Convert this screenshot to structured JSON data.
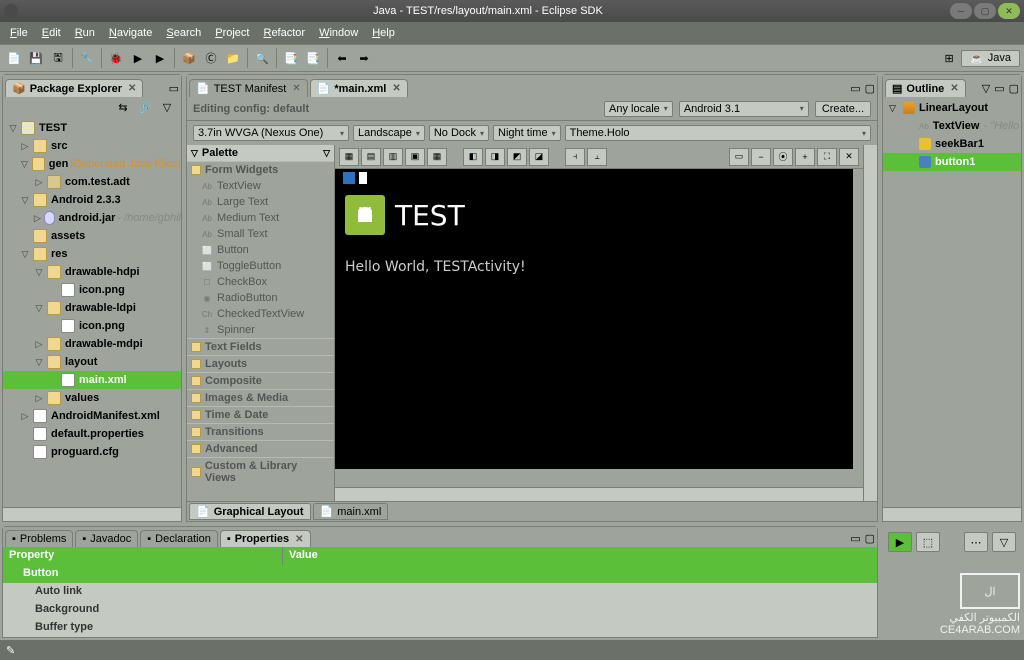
{
  "window": {
    "title": "Java - TEST/res/layout/main.xml - Eclipse SDK"
  },
  "menu": [
    "File",
    "Edit",
    "Run",
    "Navigate",
    "Search",
    "Project",
    "Refactor",
    "Window",
    "Help"
  ],
  "perspective": {
    "label": "Java"
  },
  "packageExplorer": {
    "title": "Package Explorer",
    "tree": [
      {
        "d": 0,
        "tw": "▽",
        "icon": "ic-proj",
        "label": "TEST"
      },
      {
        "d": 1,
        "tw": "▷",
        "icon": "ic-fold",
        "label": "src"
      },
      {
        "d": 1,
        "tw": "▽",
        "icon": "ic-foldG",
        "label": "gen",
        "suffix": "[Generated Java Files]",
        "sufCls": "gen"
      },
      {
        "d": 2,
        "tw": "▷",
        "icon": "ic-pkg",
        "label": "com.test.adt"
      },
      {
        "d": 1,
        "tw": "▽",
        "icon": "ic-fold",
        "label": "Android 2.3.3"
      },
      {
        "d": 2,
        "tw": "▷",
        "icon": "ic-jar",
        "label": "android.jar",
        "suffix": "- /home/gbhil",
        "sufCls": "muted"
      },
      {
        "d": 1,
        "tw": "",
        "icon": "ic-fold",
        "label": "assets"
      },
      {
        "d": 1,
        "tw": "▽",
        "icon": "ic-fold",
        "label": "res"
      },
      {
        "d": 2,
        "tw": "▽",
        "icon": "ic-fold",
        "label": "drawable-hdpi"
      },
      {
        "d": 3,
        "tw": "",
        "icon": "ic-img",
        "label": "icon.png"
      },
      {
        "d": 2,
        "tw": "▽",
        "icon": "ic-fold",
        "label": "drawable-ldpi"
      },
      {
        "d": 3,
        "tw": "",
        "icon": "ic-img",
        "label": "icon.png"
      },
      {
        "d": 2,
        "tw": "▷",
        "icon": "ic-fold",
        "label": "drawable-mdpi"
      },
      {
        "d": 2,
        "tw": "▽",
        "icon": "ic-fold",
        "label": "layout"
      },
      {
        "d": 3,
        "tw": "",
        "icon": "ic-xml",
        "label": "main.xml",
        "sel": true
      },
      {
        "d": 2,
        "tw": "▷",
        "icon": "ic-fold",
        "label": "values"
      },
      {
        "d": 1,
        "tw": "▷",
        "icon": "ic-xml",
        "label": "AndroidManifest.xml"
      },
      {
        "d": 1,
        "tw": "",
        "icon": "ic-file",
        "label": "default.properties"
      },
      {
        "d": 1,
        "tw": "",
        "icon": "ic-file",
        "label": "proguard.cfg"
      }
    ]
  },
  "editor": {
    "tabs": [
      {
        "label": "TEST Manifest",
        "active": false
      },
      {
        "label": "*main.xml",
        "active": true
      }
    ],
    "config": {
      "label": "Editing config:",
      "value": "default",
      "locale": "Any locale",
      "platform": "Android 3.1",
      "createBtn": "Create..."
    },
    "row2": {
      "device": "3.7in WVGA (Nexus One)",
      "orientation": "Landscape",
      "dock": "No Dock",
      "daynight": "Night time",
      "theme": "Theme.Holo"
    },
    "palette": {
      "title": "Palette",
      "sections": [
        {
          "type": "sect",
          "label": "Form Widgets"
        },
        {
          "type": "item",
          "icon": "Ab",
          "label": "TextView"
        },
        {
          "type": "item",
          "icon": "Ab",
          "label": "Large Text"
        },
        {
          "type": "item",
          "icon": "Ab",
          "label": "Medium Text"
        },
        {
          "type": "item",
          "icon": "Ab",
          "label": "Small Text"
        },
        {
          "type": "item",
          "icon": "⬜",
          "label": "Button"
        },
        {
          "type": "item",
          "icon": "⬜",
          "label": "ToggleButton"
        },
        {
          "type": "item",
          "icon": "☐",
          "label": "CheckBox"
        },
        {
          "type": "item",
          "icon": "◉",
          "label": "RadioButton"
        },
        {
          "type": "item",
          "icon": "Ch",
          "label": "CheckedTextView"
        },
        {
          "type": "item",
          "icon": "⇕",
          "label": "Spinner"
        },
        {
          "type": "sect",
          "label": "Text Fields"
        },
        {
          "type": "sect",
          "label": "Layouts"
        },
        {
          "type": "sect",
          "label": "Composite"
        },
        {
          "type": "sect",
          "label": "Images & Media"
        },
        {
          "type": "sect",
          "label": "Time & Date"
        },
        {
          "type": "sect",
          "label": "Transitions"
        },
        {
          "type": "sect",
          "label": "Advanced"
        },
        {
          "type": "sect",
          "label": "Custom & Library Views"
        }
      ]
    },
    "preview": {
      "title": "TEST",
      "hello": "Hello World, TESTActivity!"
    },
    "bottomTabs": [
      {
        "label": "Graphical Layout",
        "active": true
      },
      {
        "label": "main.xml",
        "active": false
      }
    ]
  },
  "outline": {
    "title": "Outline",
    "tree": [
      {
        "d": 0,
        "tw": "▽",
        "icon": "ic-ll",
        "label": "LinearLayout"
      },
      {
        "d": 1,
        "tw": "",
        "icon": "ic-tv",
        "pre": "Ab",
        "label": "TextView",
        "suffix": " - \"Hello",
        "sufCls": "muted"
      },
      {
        "d": 1,
        "tw": "",
        "icon": "ic-sb",
        "label": "seekBar1"
      },
      {
        "d": 1,
        "tw": "",
        "icon": "ic-bt",
        "label": "button1",
        "sel": true
      }
    ]
  },
  "bottom": {
    "tabs": [
      "Problems",
      "Javadoc",
      "Declaration",
      "Properties"
    ],
    "activeTab": 3,
    "header": {
      "c1": "Property",
      "c2": "Value"
    },
    "rows": [
      {
        "type": "cat",
        "label": "Button"
      },
      {
        "type": "sub",
        "label": "Auto link"
      },
      {
        "type": "sub",
        "label": "Background"
      },
      {
        "type": "sub",
        "label": "Buffer type"
      }
    ]
  },
  "watermark": {
    "ar": "الكمبيوتر الكفي",
    "url": "CE4ARAB.COM"
  }
}
